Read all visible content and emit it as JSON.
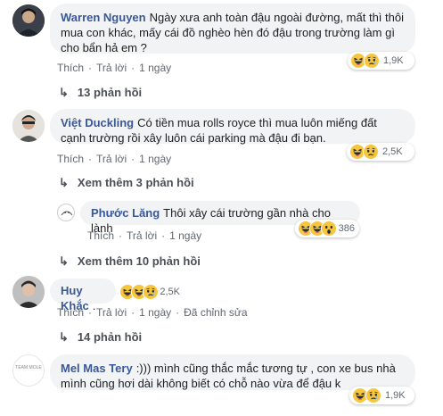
{
  "actions": {
    "like": "Thích",
    "reply": "Trả lời",
    "edited": "Đã chỉnh sửa"
  },
  "comments": [
    {
      "author": "Warren Nguyen",
      "text": "Ngày xưa anh toàn đậu ngoài đường, mất thì thôi mua con khác, mấy cái đồ nghèo hèn đó đậu trong trường làm gì cho bẩn hả em ?",
      "time": "1 ngày",
      "reactions": "1,9K",
      "replies": "13 phản hồi"
    },
    {
      "author": "Việt Duckling",
      "text": "Có tiền mua rolls royce thì mua luôn miếng đất cạnh trường rồi xây luôn cái parking mà đậu đi bạn.",
      "time": "1 ngày",
      "reactions": "2,5K",
      "more_replies": "Xem thêm 3 phản hồi",
      "reply": {
        "author": "Phước Lăng",
        "text": "Thôi xây cái trường gần nhà cho lành",
        "time": "1 ngày",
        "reactions": "386"
      },
      "more_replies_2": "Xem thêm 10 phản hồi"
    },
    {
      "author": "Huy Khắc",
      "text": ".",
      "time": "1 ngày",
      "reactions": "2,5K",
      "replies": "14 phản hồi"
    },
    {
      "author": "Mel Mas Tery",
      "text": ":))) mình cũng thắc mắc tương tự , con xe bus nhà mình cũng hơi dài không biết có chỗ nào vừa để đậu k",
      "reactions": "1,9K",
      "avatar_text": "TEAM MOLE"
    }
  ],
  "colors": {
    "link": "#385898",
    "bubble": "#f2f3f5",
    "meta": "#606770"
  }
}
